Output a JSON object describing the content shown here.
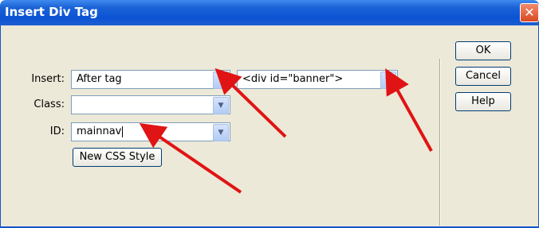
{
  "dialog": {
    "title": "Insert Div Tag",
    "close_glyph": "✕"
  },
  "form": {
    "insert_label": "Insert:",
    "insert_value": "After tag",
    "target_value": "<div id=\"banner\">",
    "class_label": "Class:",
    "class_value": "",
    "id_label": "ID:",
    "id_value": "mainnav",
    "new_css_style_label": "New CSS Style"
  },
  "buttons": {
    "ok": "OK",
    "cancel": "Cancel",
    "help": "Help"
  },
  "icons": {
    "dropdown": "▼"
  },
  "annotation_color": "#e01414"
}
